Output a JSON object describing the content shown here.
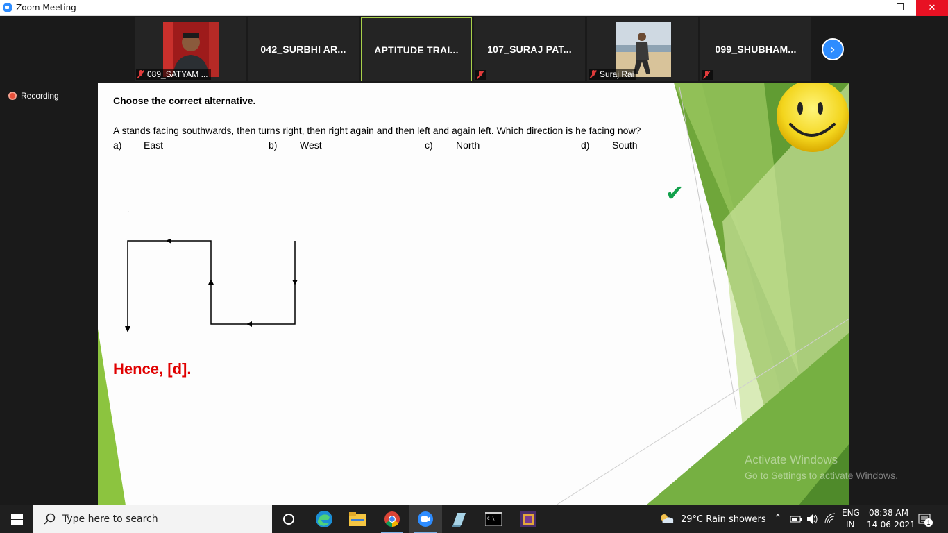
{
  "window": {
    "title": "Zoom Meeting",
    "minimize": "—",
    "restore": "❐",
    "close": "✕"
  },
  "participants": [
    {
      "label": "089_SATYAM ...",
      "type": "video"
    },
    {
      "name": "042_SURBHI AR...",
      "type": "name"
    },
    {
      "name": "APTITUDE TRAI...",
      "type": "name",
      "active": true
    },
    {
      "name": "107_SURAJ PAT...",
      "type": "name"
    },
    {
      "label": "Suraj Rai",
      "type": "video"
    },
    {
      "name": "099_SHUBHAM...",
      "type": "name"
    }
  ],
  "recording": {
    "label": "Recording"
  },
  "slide": {
    "heading": "Choose the correct alternative.",
    "question": "A stands facing southwards, then turns right, then right again and then left and again left. Which direction is he facing now?",
    "options": [
      {
        "key": "a)",
        "text": "East"
      },
      {
        "key": "b)",
        "text": "West"
      },
      {
        "key": "c)",
        "text": "North"
      },
      {
        "key": "d)",
        "text": "South"
      }
    ],
    "dot": ".",
    "tick": "✔",
    "answer": "Hence, [d]."
  },
  "watermark": {
    "title": "Activate Windows",
    "subtitle": "Go to Settings to activate Windows."
  },
  "taskbar": {
    "search_placeholder": "Type here to search",
    "weather": "29°C  Rain showers",
    "lang_top": "ENG",
    "lang_bottom": "IN",
    "time": "08:38 AM",
    "date": "14-06-2021",
    "notification_count": "1"
  }
}
